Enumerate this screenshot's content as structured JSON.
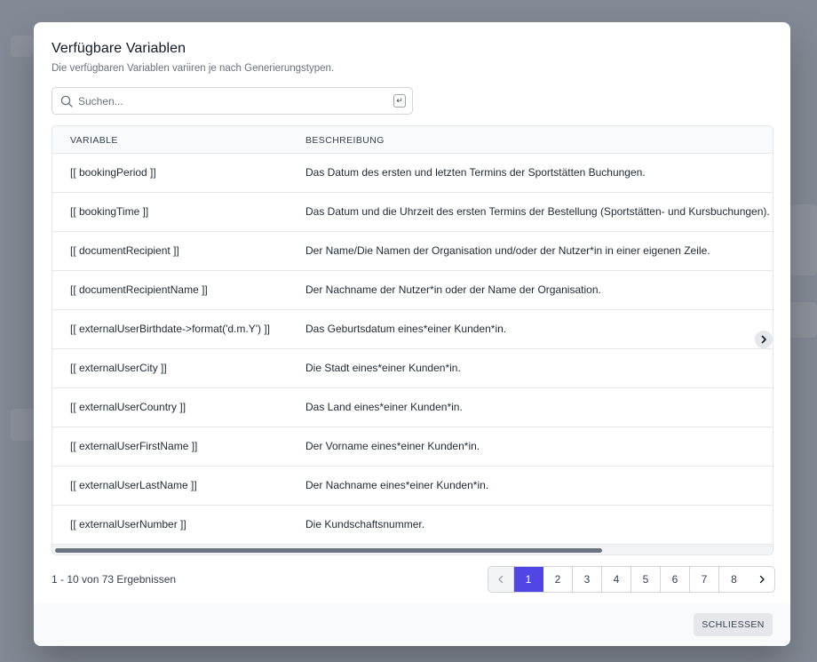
{
  "modal": {
    "title": "Verfügbare Variablen",
    "subtitle": "Die verfügbaren Variablen variiren je nach Generierungstypen."
  },
  "search": {
    "placeholder": "Suchen...",
    "value": "",
    "enter_key": "↵"
  },
  "table": {
    "headers": {
      "variable": "VARIABLE",
      "description": "BESCHREIBUNG"
    },
    "rows": [
      {
        "variable": "[[ bookingPeriod ]]",
        "description": "Das Datum des ersten und letzten Termins der Sportstätten Buchungen."
      },
      {
        "variable": "[[ bookingTime ]]",
        "description": "Das Datum und die Uhrzeit des ersten Termins der Bestellung (Sportstätten- und Kursbuchungen). U"
      },
      {
        "variable": "[[ documentRecipient ]]",
        "description": "Der Name/Die Namen der Organisation und/oder der Nutzer*in in einer eigenen Zeile."
      },
      {
        "variable": "[[ documentRecipientName ]]",
        "description": "Der Nachname der Nutzer*in oder der Name der Organisation."
      },
      {
        "variable": "[[ externalUserBirthdate->format('d.m.Y') ]]",
        "description": "Das Geburtsdatum eines*einer Kunden*in."
      },
      {
        "variable": "[[ externalUserCity ]]",
        "description": "Die Stadt eines*einer Kunden*in."
      },
      {
        "variable": "[[ externalUserCountry ]]",
        "description": "Das Land eines*einer Kunden*in."
      },
      {
        "variable": "[[ externalUserFirstName ]]",
        "description": "Der Vorname eines*einer Kunden*in."
      },
      {
        "variable": "[[ externalUserLastName ]]",
        "description": "Der Nachname eines*einer Kunden*in."
      },
      {
        "variable": "[[ externalUserNumber ]]",
        "description": "Die Kundschaftsnummer."
      }
    ]
  },
  "pagination": {
    "summary": "1 - 10 von 73 Ergebnissen",
    "pages": [
      "1",
      "2",
      "3",
      "4",
      "5",
      "6",
      "7",
      "8"
    ],
    "active_page": "1"
  },
  "footer": {
    "close_label": "SCHLIESSEN"
  },
  "colors": {
    "accent": "#4f46e5",
    "overlay": "#6b7280"
  }
}
